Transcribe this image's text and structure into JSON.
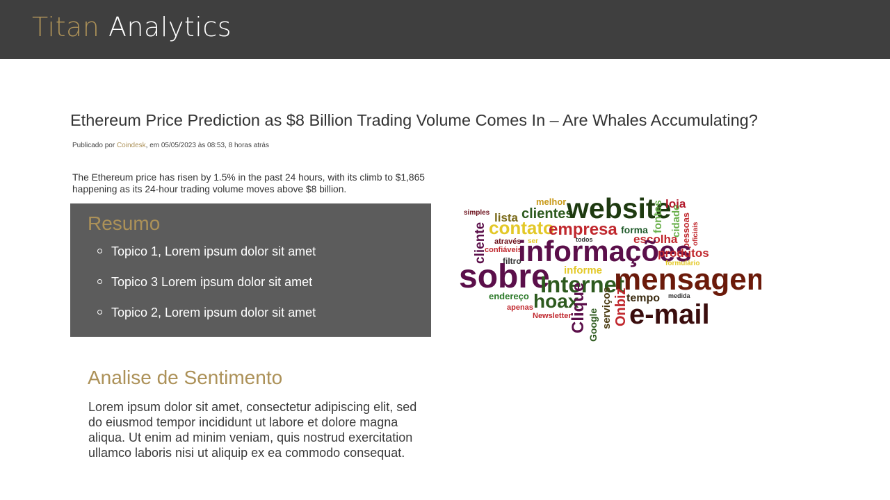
{
  "header": {
    "brand_part1": "Titan",
    "brand_part2": "Analytics"
  },
  "article": {
    "title": "Ethereum Price Prediction as $8 Billion Trading Volume Comes In – Are Whales Accumulating?",
    "byline_prefix": "Publicado por ",
    "source": "Coindesk",
    "byline_suffix": ", em 05/05/2023 às 08:53, 8 horas atrás",
    "intro": "The Ethereum price has risen by 1.5% in the past 24 hours, with its climb to $1,865 happening as its 24-hour trading volume moves above $8 billion."
  },
  "summary": {
    "title": "Resumo",
    "items": [
      "Topico 1, Lorem ipsum dolor sit amet",
      "Topico 3 Lorem ipsum dolor sit amet",
      "Topico 2, Lorem ipsum dolor sit amet"
    ]
  },
  "sentiment": {
    "title": "Analise de Sentimento",
    "body": "Lorem ipsum dolor sit amet, consectetur adipiscing elit, sed do eiusmod tempor incididunt ut labore et dolore magna aliqua. Ut enim ad minim veniam, quis nostrud exercitation ullamco laboris nisi ut aliquip ex ea commodo consequat."
  },
  "wordcloud": {
    "words": {
      "simples": "simples",
      "lista": "lista",
      "melhor": "melhor",
      "clientes": "clientes",
      "website": "website",
      "loja": "loja",
      "contato": "contato",
      "empresa": "empresa",
      "forma": "forma",
      "fontes": "fontes",
      "cidade": "cidade",
      "pessoas": "pessoas",
      "oficiais": "oficiais",
      "cliente": "cliente",
      "atraves": "através",
      "ser": "ser",
      "todos": "todos",
      "escolha": "escolha",
      "confiaveis": "confiáveis",
      "informacoes": "informações",
      "produtos": "produtos",
      "filtro": "filtro",
      "formulario": "formulário",
      "sobre": "sobre",
      "informe": "informe",
      "internet": "Internet",
      "mensagem": "mensagem",
      "endereco": "endereço",
      "hoax": "hoax",
      "tempo": "tempo",
      "medida": "medida",
      "apenas": "apenas",
      "onbiz": "Onbiz",
      "email": "e-mail",
      "newsletter": "Newsletter",
      "clique": "Clique",
      "servicos": "serviços",
      "google": "Google"
    }
  }
}
